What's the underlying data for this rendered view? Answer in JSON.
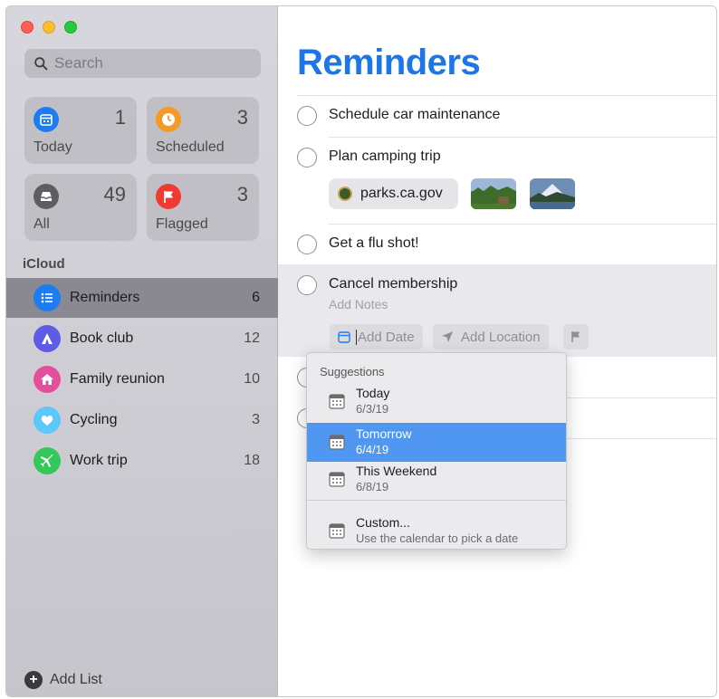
{
  "sidebar": {
    "search": {
      "placeholder": "Search"
    },
    "smart_lists": [
      {
        "label": "Today",
        "count": "1",
        "icon": "calendar-icon",
        "color": "#1e7cf2"
      },
      {
        "label": "Scheduled",
        "count": "3",
        "icon": "clock-icon",
        "color": "#f59a23"
      },
      {
        "label": "All",
        "count": "49",
        "icon": "tray-icon",
        "color": "#5d5d62"
      },
      {
        "label": "Flagged",
        "count": "3",
        "icon": "flag-icon",
        "color": "#ef3b32"
      }
    ],
    "section_title": "iCloud",
    "lists": [
      {
        "name": "Reminders",
        "count": "6",
        "icon": "list-icon",
        "color": "#1e7cf2",
        "selected": true
      },
      {
        "name": "Book club",
        "count": "12",
        "icon": "tent-icon",
        "color": "#5e5ce6"
      },
      {
        "name": "Family reunion",
        "count": "10",
        "icon": "house-icon",
        "color": "#e34f9a"
      },
      {
        "name": "Cycling",
        "count": "3",
        "icon": "heart-icon",
        "color": "#5ac8fa"
      },
      {
        "name": "Work trip",
        "count": "18",
        "icon": "airplane-icon",
        "color": "#34c759"
      }
    ],
    "add_list_label": "Add List"
  },
  "main": {
    "title": "Reminders",
    "accent_color": "#1b76e8",
    "tasks": [
      {
        "title": "Schedule car maintenance"
      },
      {
        "title": "Plan camping trip",
        "link": "parks.ca.gov"
      },
      {
        "title": "Get a flu shot!"
      },
      {
        "title": "Cancel membership",
        "notes_placeholder": "Add Notes",
        "actions": {
          "add_date": "Add Date",
          "add_location": "Add Location"
        }
      }
    ]
  },
  "popover": {
    "header": "Suggestions",
    "items": [
      {
        "label": "Today",
        "sub": "6/3/19"
      },
      {
        "label": "Tomorrow",
        "sub": "6/4/19",
        "highlighted": true
      },
      {
        "label": "This Weekend",
        "sub": "6/8/19"
      },
      {
        "label": "Custom...",
        "sub": "Use the calendar to pick a date"
      }
    ],
    "highlight_color": "#4f97f1"
  }
}
